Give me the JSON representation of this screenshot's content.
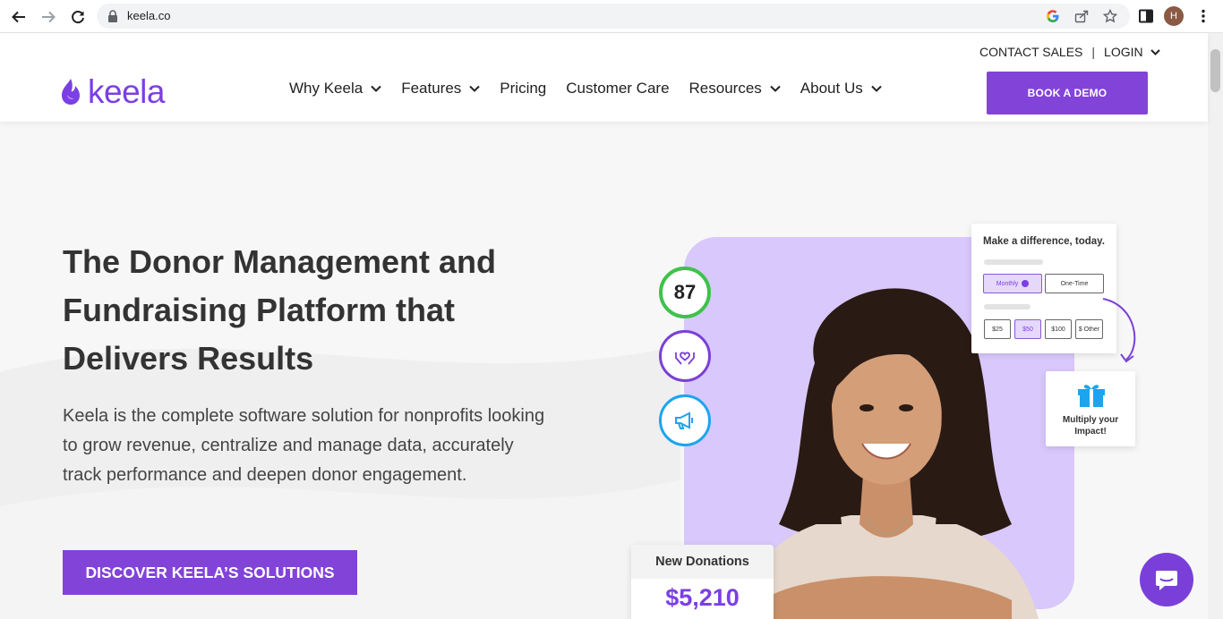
{
  "browser": {
    "url": "keela.co",
    "profile_initial": "H"
  },
  "header": {
    "logo_text": "keela",
    "nav": [
      {
        "label": "Why Keela",
        "has_dropdown": true
      },
      {
        "label": "Features",
        "has_dropdown": true
      },
      {
        "label": "Pricing",
        "has_dropdown": false
      },
      {
        "label": "Customer Care",
        "has_dropdown": false
      },
      {
        "label": "Resources",
        "has_dropdown": true
      },
      {
        "label": "About Us",
        "has_dropdown": true
      }
    ],
    "contact_sales": "CONTACT SALES",
    "separator": "|",
    "login": "LOGIN",
    "book_demo": "BOOK A DEMO"
  },
  "hero": {
    "headline": "The Donor Management and Fundraising Platform that Delivers Results",
    "subhead": "Keela is the complete software solution for nonprofits looking to grow revenue, centralize and manage data, accurately track performance and deepen donor engagement.",
    "cta": "DISCOVER KEELA’S SOLUTIONS"
  },
  "visual": {
    "score": "87",
    "donate_card": {
      "title": "Make a difference, today.",
      "frequency": [
        "Monthly",
        "One-Time"
      ],
      "amounts": [
        "$25",
        "$50",
        "$100",
        "$ Other"
      ]
    },
    "gift_text": "Multiply your Impact!",
    "donations_label": "New Donations",
    "donations_value": "$5,210"
  },
  "colors": {
    "brand_purple": "#8243d9",
    "score_green": "#3ec24b",
    "megaphone_blue": "#1ba5ef"
  }
}
